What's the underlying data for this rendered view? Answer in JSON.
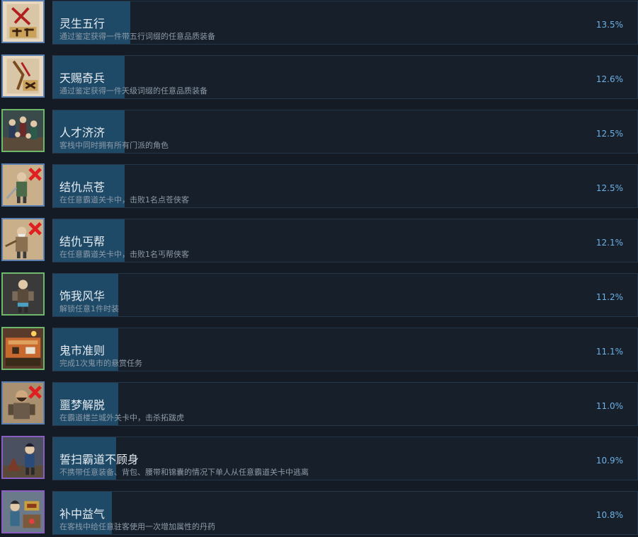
{
  "achievements": [
    {
      "title": "灵生五行",
      "desc": "通过鉴定获得一件带五行词缀的任意品质装备",
      "percent": "13.5%",
      "icon": "five-elements-scroll-icon",
      "frame": "blue",
      "fill_fraction": 0.135
    },
    {
      "title": "天赐奇兵",
      "desc": "通过鉴定获得一件天级词缀的任意品质装备",
      "percent": "12.6%",
      "icon": "heavenly-weapon-scroll-icon",
      "frame": "blue",
      "fill_fraction": 0.126
    },
    {
      "title": "人才济济",
      "desc": "客栈中同时拥有所有门派的角色",
      "percent": "12.5%",
      "icon": "crowd-of-heroes-icon",
      "frame": "green",
      "fill_fraction": 0.125
    },
    {
      "title": "结仇点苍",
      "desc": "在任意霸道关卡中，击败1名点苍侠客",
      "percent": "12.5%",
      "icon": "defeated-diancang-swordsman-icon",
      "frame": "blue",
      "fill_fraction": 0.125
    },
    {
      "title": "结仇丐帮",
      "desc": "在任意霸道关卡中，击败1名丐帮侠客",
      "percent": "12.1%",
      "icon": "defeated-beggar-elder-icon",
      "frame": "blue",
      "fill_fraction": 0.121
    },
    {
      "title": "饰我风华",
      "desc": "解锁任意1件时装",
      "percent": "11.2%",
      "icon": "costume-character-icon",
      "frame": "green",
      "fill_fraction": 0.112
    },
    {
      "title": "鬼市准则",
      "desc": "完成1次鬼市的悬赏任务",
      "percent": "11.1%",
      "icon": "ghost-market-stall-icon",
      "frame": "green",
      "fill_fraction": 0.111
    },
    {
      "title": "噩梦解脱",
      "desc": "在霸道楼兰城外关卡中，击杀拓跋虎",
      "percent": "11.0%",
      "icon": "defeated-tuoba-hu-icon",
      "frame": "blue",
      "fill_fraction": 0.11
    },
    {
      "title": "誓扫霸道不顾身",
      "desc": "不携带任意装备、背包、腰带和锦囊的情况下单人从任意霸道关卡中逃离",
      "percent": "10.9%",
      "icon": "lone-escapee-icon",
      "frame": "purple",
      "fill_fraction": 0.109
    },
    {
      "title": "补中益气",
      "desc": "在客栈中给任意驻客使用一次增加属性的丹药",
      "percent": "10.8%",
      "icon": "elixir-innkeeper-icon",
      "frame": "purple",
      "fill_fraction": 0.108
    }
  ]
}
